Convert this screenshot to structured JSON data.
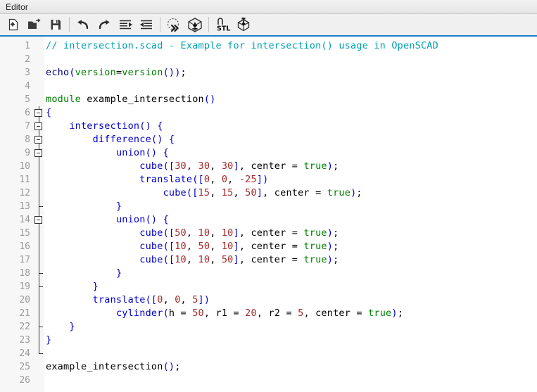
{
  "window": {
    "title": "Editor"
  },
  "toolbar": {
    "buttons": [
      {
        "name": "new-file-icon",
        "label": "New"
      },
      {
        "name": "open-folder-icon",
        "label": "Open"
      },
      {
        "name": "save-icon",
        "label": "Save"
      },
      {
        "name": "undo-icon",
        "label": "Undo"
      },
      {
        "name": "redo-icon",
        "label": "Redo"
      },
      {
        "name": "unindent-icon",
        "label": "Unindent"
      },
      {
        "name": "indent-icon",
        "label": "Indent"
      },
      {
        "name": "preview-icon",
        "label": "Preview"
      },
      {
        "name": "render-icon",
        "label": "Render"
      },
      {
        "name": "export-stl-icon",
        "label": "Export as STL"
      },
      {
        "name": "export-icon",
        "label": "Export"
      }
    ]
  },
  "editor": {
    "accent_color": "#1b7fc4",
    "gutter_bg": "#f7f7f7",
    "code_bg": "#ffffff",
    "line_number_color": "#9a9a9a",
    "colors": {
      "comment": "#00a0b4",
      "keyword": "#008000",
      "module": "#0000cc",
      "number": "#a52a2a",
      "boolean": "#008000",
      "plain": "#000000"
    },
    "line_count": 26,
    "first_line": 1,
    "lines": [
      {
        "n": 1,
        "fold": "none",
        "tokens": [
          {
            "t": "comment",
            "v": "// intersection.scad - Example for intersection() usage in OpenSCAD"
          }
        ]
      },
      {
        "n": 2,
        "fold": "none",
        "tokens": []
      },
      {
        "n": 3,
        "fold": "none",
        "tokens": [
          {
            "t": "func",
            "v": "echo"
          },
          {
            "t": "punct",
            "v": "("
          },
          {
            "t": "green",
            "v": "version"
          },
          {
            "t": "plain",
            "v": "="
          },
          {
            "t": "green",
            "v": "version"
          },
          {
            "t": "punct",
            "v": "()"
          },
          {
            "t": "punct",
            "v": ")"
          },
          {
            "t": "plain",
            "v": ";"
          }
        ]
      },
      {
        "n": 4,
        "fold": "none",
        "tokens": []
      },
      {
        "n": 5,
        "fold": "none",
        "tokens": [
          {
            "t": "keyword",
            "v": "module"
          },
          {
            "t": "plain",
            "v": " example_intersection"
          },
          {
            "t": "punct",
            "v": "()"
          }
        ]
      },
      {
        "n": 6,
        "fold": "open",
        "tokens": [
          {
            "t": "brace",
            "v": "{"
          }
        ]
      },
      {
        "n": 7,
        "fold": "open",
        "tokens": [
          {
            "t": "plain",
            "v": "    "
          },
          {
            "t": "module",
            "v": "intersection"
          },
          {
            "t": "punct",
            "v": "()"
          },
          {
            "t": "plain",
            "v": " "
          },
          {
            "t": "brace",
            "v": "{"
          }
        ]
      },
      {
        "n": 8,
        "fold": "open",
        "tokens": [
          {
            "t": "plain",
            "v": "        "
          },
          {
            "t": "module",
            "v": "difference"
          },
          {
            "t": "punct",
            "v": "()"
          },
          {
            "t": "plain",
            "v": " "
          },
          {
            "t": "brace",
            "v": "{"
          }
        ]
      },
      {
        "n": 9,
        "fold": "open",
        "tokens": [
          {
            "t": "plain",
            "v": "            "
          },
          {
            "t": "module",
            "v": "union"
          },
          {
            "t": "punct",
            "v": "()"
          },
          {
            "t": "plain",
            "v": " "
          },
          {
            "t": "brace",
            "v": "{"
          }
        ]
      },
      {
        "n": 10,
        "fold": "line",
        "tokens": [
          {
            "t": "plain",
            "v": "                "
          },
          {
            "t": "module",
            "v": "cube"
          },
          {
            "t": "punct",
            "v": "(["
          },
          {
            "t": "num",
            "v": "30"
          },
          {
            "t": "plain",
            "v": ", "
          },
          {
            "t": "num",
            "v": "30"
          },
          {
            "t": "plain",
            "v": ", "
          },
          {
            "t": "num",
            "v": "30"
          },
          {
            "t": "punct",
            "v": "]"
          },
          {
            "t": "plain",
            "v": ", center "
          },
          {
            "t": "plain",
            "v": "= "
          },
          {
            "t": "bool",
            "v": "true"
          },
          {
            "t": "punct",
            "v": ")"
          },
          {
            "t": "plain",
            "v": ";"
          }
        ]
      },
      {
        "n": 11,
        "fold": "line",
        "tokens": [
          {
            "t": "plain",
            "v": "                "
          },
          {
            "t": "module",
            "v": "translate"
          },
          {
            "t": "punct",
            "v": "(["
          },
          {
            "t": "num",
            "v": "0"
          },
          {
            "t": "plain",
            "v": ", "
          },
          {
            "t": "num",
            "v": "0"
          },
          {
            "t": "plain",
            "v": ", "
          },
          {
            "t": "num",
            "v": "-25"
          },
          {
            "t": "punct",
            "v": "])"
          }
        ]
      },
      {
        "n": 12,
        "fold": "line",
        "tokens": [
          {
            "t": "plain",
            "v": "                    "
          },
          {
            "t": "module",
            "v": "cube"
          },
          {
            "t": "punct",
            "v": "(["
          },
          {
            "t": "num",
            "v": "15"
          },
          {
            "t": "plain",
            "v": ", "
          },
          {
            "t": "num",
            "v": "15"
          },
          {
            "t": "plain",
            "v": ", "
          },
          {
            "t": "num",
            "v": "50"
          },
          {
            "t": "punct",
            "v": "]"
          },
          {
            "t": "plain",
            "v": ", center "
          },
          {
            "t": "plain",
            "v": "= "
          },
          {
            "t": "bool",
            "v": "true"
          },
          {
            "t": "punct",
            "v": ")"
          },
          {
            "t": "plain",
            "v": ";"
          }
        ]
      },
      {
        "n": 13,
        "fold": "tick",
        "tokens": [
          {
            "t": "plain",
            "v": "            "
          },
          {
            "t": "brace",
            "v": "}"
          }
        ]
      },
      {
        "n": 14,
        "fold": "open",
        "tokens": [
          {
            "t": "plain",
            "v": "            "
          },
          {
            "t": "module",
            "v": "union"
          },
          {
            "t": "punct",
            "v": "()"
          },
          {
            "t": "plain",
            "v": " "
          },
          {
            "t": "brace",
            "v": "{"
          }
        ]
      },
      {
        "n": 15,
        "fold": "line",
        "tokens": [
          {
            "t": "plain",
            "v": "                "
          },
          {
            "t": "module",
            "v": "cube"
          },
          {
            "t": "punct",
            "v": "(["
          },
          {
            "t": "num",
            "v": "50"
          },
          {
            "t": "plain",
            "v": ", "
          },
          {
            "t": "num",
            "v": "10"
          },
          {
            "t": "plain",
            "v": ", "
          },
          {
            "t": "num",
            "v": "10"
          },
          {
            "t": "punct",
            "v": "]"
          },
          {
            "t": "plain",
            "v": ", center "
          },
          {
            "t": "plain",
            "v": "= "
          },
          {
            "t": "bool",
            "v": "true"
          },
          {
            "t": "punct",
            "v": ")"
          },
          {
            "t": "plain",
            "v": ";"
          }
        ]
      },
      {
        "n": 16,
        "fold": "line",
        "tokens": [
          {
            "t": "plain",
            "v": "                "
          },
          {
            "t": "module",
            "v": "cube"
          },
          {
            "t": "punct",
            "v": "(["
          },
          {
            "t": "num",
            "v": "10"
          },
          {
            "t": "plain",
            "v": ", "
          },
          {
            "t": "num",
            "v": "50"
          },
          {
            "t": "plain",
            "v": ", "
          },
          {
            "t": "num",
            "v": "10"
          },
          {
            "t": "punct",
            "v": "]"
          },
          {
            "t": "plain",
            "v": ", center "
          },
          {
            "t": "plain",
            "v": "= "
          },
          {
            "t": "bool",
            "v": "true"
          },
          {
            "t": "punct",
            "v": ")"
          },
          {
            "t": "plain",
            "v": ";"
          }
        ]
      },
      {
        "n": 17,
        "fold": "line",
        "tokens": [
          {
            "t": "plain",
            "v": "                "
          },
          {
            "t": "module",
            "v": "cube"
          },
          {
            "t": "punct",
            "v": "(["
          },
          {
            "t": "num",
            "v": "10"
          },
          {
            "t": "plain",
            "v": ", "
          },
          {
            "t": "num",
            "v": "10"
          },
          {
            "t": "plain",
            "v": ", "
          },
          {
            "t": "num",
            "v": "50"
          },
          {
            "t": "punct",
            "v": "]"
          },
          {
            "t": "plain",
            "v": ", center "
          },
          {
            "t": "plain",
            "v": "= "
          },
          {
            "t": "bool",
            "v": "true"
          },
          {
            "t": "punct",
            "v": ")"
          },
          {
            "t": "plain",
            "v": ";"
          }
        ]
      },
      {
        "n": 18,
        "fold": "tick",
        "tokens": [
          {
            "t": "plain",
            "v": "            "
          },
          {
            "t": "brace",
            "v": "}"
          }
        ]
      },
      {
        "n": 19,
        "fold": "tick",
        "tokens": [
          {
            "t": "plain",
            "v": "        "
          },
          {
            "t": "brace",
            "v": "}"
          }
        ]
      },
      {
        "n": 20,
        "fold": "line",
        "tokens": [
          {
            "t": "plain",
            "v": "        "
          },
          {
            "t": "module",
            "v": "translate"
          },
          {
            "t": "punct",
            "v": "(["
          },
          {
            "t": "num",
            "v": "0"
          },
          {
            "t": "plain",
            "v": ", "
          },
          {
            "t": "num",
            "v": "0"
          },
          {
            "t": "plain",
            "v": ", "
          },
          {
            "t": "num",
            "v": "5"
          },
          {
            "t": "punct",
            "v": "])"
          }
        ]
      },
      {
        "n": 21,
        "fold": "line",
        "tokens": [
          {
            "t": "plain",
            "v": "            "
          },
          {
            "t": "module",
            "v": "cylinder"
          },
          {
            "t": "punct",
            "v": "("
          },
          {
            "t": "plain",
            "v": "h = "
          },
          {
            "t": "num",
            "v": "50"
          },
          {
            "t": "plain",
            "v": ", r1 = "
          },
          {
            "t": "num",
            "v": "20"
          },
          {
            "t": "plain",
            "v": ", r2 = "
          },
          {
            "t": "num",
            "v": "5"
          },
          {
            "t": "plain",
            "v": ", center = "
          },
          {
            "t": "bool",
            "v": "true"
          },
          {
            "t": "punct",
            "v": ")"
          },
          {
            "t": "plain",
            "v": ";"
          }
        ]
      },
      {
        "n": 22,
        "fold": "tick",
        "tokens": [
          {
            "t": "plain",
            "v": "    "
          },
          {
            "t": "brace",
            "v": "}"
          }
        ]
      },
      {
        "n": 23,
        "fold": "line",
        "tokens": [
          {
            "t": "brace",
            "v": "}"
          }
        ]
      },
      {
        "n": 24,
        "fold": "end",
        "tokens": []
      },
      {
        "n": 25,
        "fold": "none",
        "tokens": [
          {
            "t": "plain",
            "v": "example_intersection"
          },
          {
            "t": "punct",
            "v": "()"
          },
          {
            "t": "plain",
            "v": ";"
          }
        ]
      },
      {
        "n": 26,
        "fold": "none",
        "tokens": []
      }
    ]
  }
}
